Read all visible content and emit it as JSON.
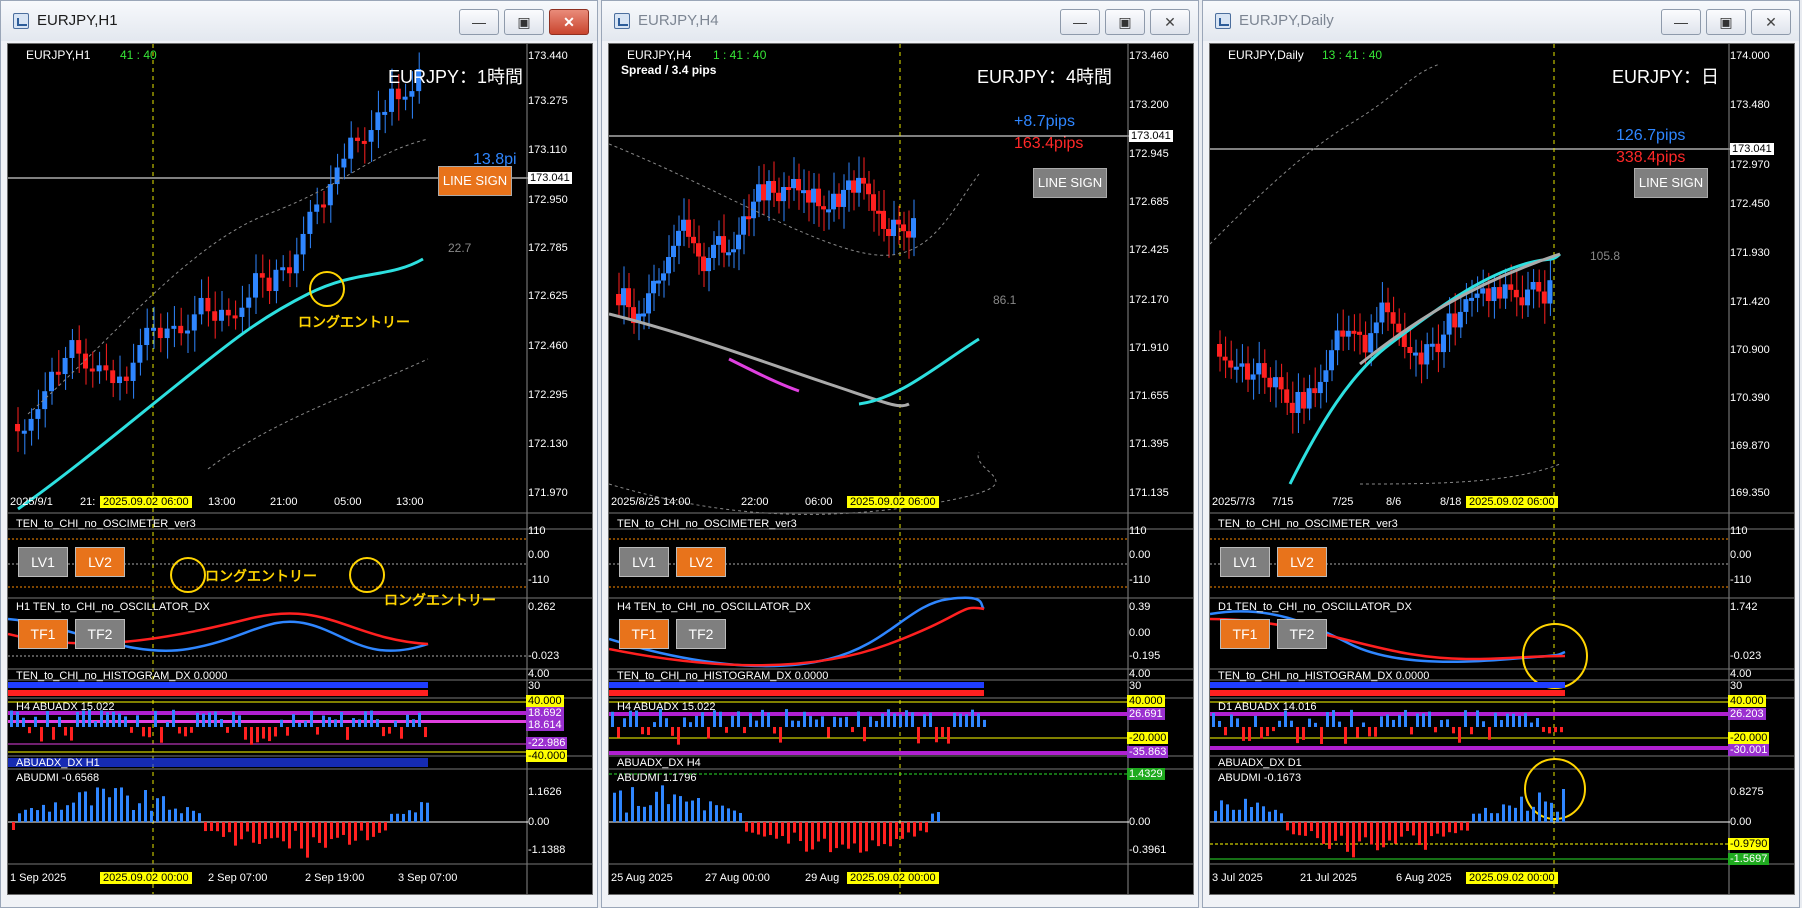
{
  "windows": [
    {
      "title": "EURJPY,H1",
      "symbol": "EURJPY,H1",
      "timer": "41 : 40",
      "label": "EURJPY：1時間",
      "pips_up": "13.8pi",
      "pips_down": "",
      "line_sign": "LINE SIGN",
      "ma_value": "22.7",
      "annotations": [
        "ロングエントリー",
        "ロングエントリー",
        "ロングエントリー"
      ],
      "price_axis": [
        "173.440",
        "173.275",
        "173.110",
        "173.041",
        "172.950",
        "172.785",
        "172.625",
        "172.460",
        "172.295",
        "172.130",
        "171.970"
      ],
      "time_axis": [
        "2025/9/1",
        "21:",
        "2025.09.02 06:00",
        "13:00",
        "21:00",
        "05:00",
        "13:00"
      ],
      "bottom_axis": [
        "1 Sep 2025",
        "2025.09.02 00:00",
        "2 Sep 07:00",
        "2 Sep 19:00",
        "3 Sep 07:00"
      ],
      "osc1": {
        "label": "TEN_to_CHI_no_OSCIMETER_ver3",
        "ticks": [
          "110",
          "0.00",
          "-110"
        ]
      },
      "buttons_lv": [
        "LV1",
        "LV2"
      ],
      "osc2": {
        "label": "H1 TEN_to_CHI_no_OSCILLATOR_DX",
        "ticks": [
          "0.262",
          "-0.023"
        ]
      },
      "buttons_tf": [
        "TF1",
        "TF2"
      ],
      "hist": {
        "label": "TEN_to_CHI_no_HISTOGRAM_DX 0.0000",
        "ticks": [
          "4.00",
          "30"
        ]
      },
      "abuadx": {
        "label": "H4 ABUADX  15.022",
        "ticks": [
          "40.000",
          "18.692",
          "18.614",
          "-22.986",
          "-40.000"
        ]
      },
      "abuadx2": {
        "label": "ABUADX_DX H1"
      },
      "abudmi": {
        "label": "ABUDMI  -0.6568",
        "ticks": [
          "1.1626",
          "0.00",
          "-1.1388"
        ]
      }
    },
    {
      "title": "EURJPY,H4",
      "symbol": "EURJPY,H4",
      "timer": "1 : 41 : 40",
      "spread": "Spread / 3.4 pips",
      "label": "EURJPY：4時間",
      "pips_up": "+8.7pips",
      "pips_down": "163.4pips",
      "line_sign": "LINE SIGN",
      "ma_value": "86.1",
      "price_axis": [
        "173.460",
        "173.200",
        "173.041",
        "172.945",
        "172.685",
        "172.425",
        "172.170",
        "171.910",
        "171.655",
        "171.395",
        "171.135"
      ],
      "time_axis": [
        "2025/8/25 14:00",
        "22:00",
        "06:00",
        "2025.09.02 06:00"
      ],
      "bottom_axis": [
        "25 Aug 2025",
        "27 Aug 00:00",
        "29 Aug",
        "2025.09.02 00:00"
      ],
      "osc1": {
        "label": "TEN_to_CHI_no_OSCIMETER_ver3",
        "ticks": [
          "110",
          "0.00",
          "-110"
        ]
      },
      "buttons_lv": [
        "LV1",
        "LV2"
      ],
      "osc2": {
        "label": "H4 TEN_to_CHI_no_OSCILLATOR_DX",
        "ticks": [
          "0.39",
          "0.00",
          "-0.195"
        ]
      },
      "buttons_tf": [
        "TF1",
        "TF2"
      ],
      "hist": {
        "label": "TEN_to_CHI_no_HISTOGRAM_DX 0.0000",
        "ticks": [
          "4.00",
          "30"
        ]
      },
      "abuadx": {
        "label": "H4 ABUADX  15.022",
        "ticks": [
          "40.000",
          "26.691",
          "-20.000",
          "-35.863"
        ]
      },
      "abuadx2": {
        "label": "ABUADX_DX H4"
      },
      "abudmi": {
        "label": "ABUDMI  1.1796",
        "ticks": [
          "1.4329",
          "0.00",
          "-0.3961"
        ]
      }
    },
    {
      "title": "EURJPY,Daily",
      "symbol": "EURJPY,Daily",
      "timer": "13 : 41 : 40",
      "label": "EURJPY：日",
      "pips_up": "126.7pips",
      "pips_down": "338.4pips",
      "line_sign": "LINE SIGN",
      "ma_value": "105.8",
      "price_axis": [
        "174.000",
        "173.480",
        "173.041",
        "172.970",
        "172.450",
        "171.930",
        "171.420",
        "170.900",
        "170.390",
        "169.870",
        "169.350"
      ],
      "time_axis": [
        "2025/7/3",
        "7/15",
        "7/25",
        "8/6",
        "8/18",
        "2025.09.02 06:00"
      ],
      "bottom_axis": [
        "3 Jul 2025",
        "21 Jul 2025",
        "6 Aug 2025",
        "2025.09.02 00:00"
      ],
      "osc1": {
        "label": "TEN_to_CHI_no_OSCIMETER_ver3",
        "ticks": [
          "110",
          "0.00",
          "-110"
        ]
      },
      "buttons_lv": [
        "LV1",
        "LV2"
      ],
      "osc2": {
        "label": "D1 TEN_to_CHI_no_OSCILLATOR_DX",
        "ticks": [
          "1.742",
          "-0.023"
        ]
      },
      "buttons_tf": [
        "TF1",
        "TF2"
      ],
      "hist": {
        "label": "TEN_to_CHI_no_HISTOGRAM_DX 0.0000",
        "ticks": [
          "4.00",
          "30"
        ]
      },
      "abuadx": {
        "label": "D1 ABUADX  14.016",
        "ticks": [
          "40.000",
          "26.203",
          "-20.000",
          "-30.001"
        ]
      },
      "abuadx2": {
        "label": "ABUADX_DX D1"
      },
      "abudmi": {
        "label": "ABUDMI  -0.1673",
        "ticks": [
          "0.8275",
          "0.00",
          "-0.9790",
          "-1.5697"
        ]
      }
    }
  ],
  "colors": {
    "bull": "#2f86ff",
    "bear": "#ff2020",
    "ma": "#2de0e0",
    "accent": "#ffd400"
  }
}
